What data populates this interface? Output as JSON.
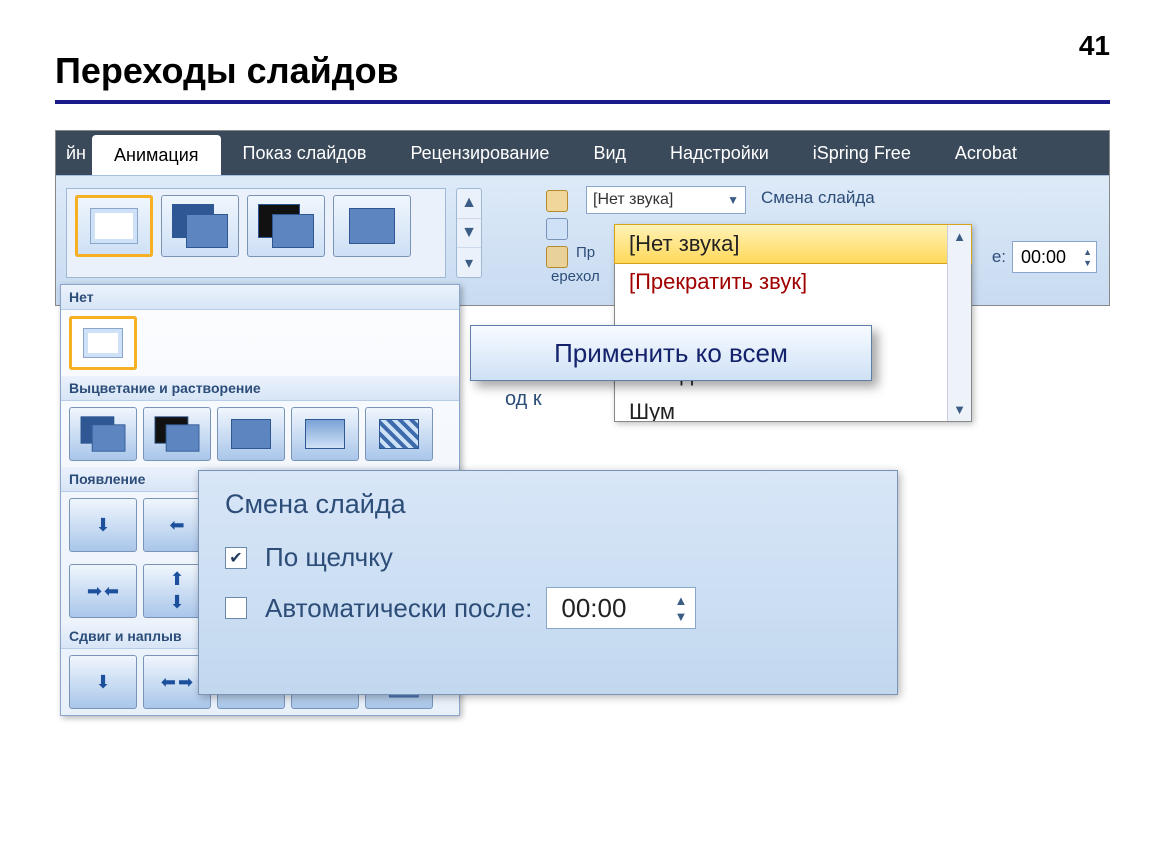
{
  "page": {
    "number": "41",
    "title": "Переходы слайдов"
  },
  "ribbon": {
    "partial_prev_tab": "йн",
    "tabs": [
      "Анимация",
      "Показ слайдов",
      "Рецензирование",
      "Вид",
      "Надстройки",
      "iSpring Free",
      "Acrobat"
    ],
    "active_tab": "Анимация",
    "sound_combo_value": "[Нет звука]",
    "advance_section_label": "Смена слайда",
    "time_suffix_label": "е:",
    "time_value": "00:00",
    "behind_text1": "Пр",
    "behind_text2": "ерехол",
    "behind_text3": "од к"
  },
  "gallery": {
    "group_none": "Нет",
    "group_fade": "Выцветание и растворение",
    "group_appear": "Появление",
    "group_push": "Сдвиг и наплыв"
  },
  "sound_dropdown": {
    "items": [
      "[Нет звука]",
      "[Прекратить звук]",
      "Аплодисменты",
      "Шум"
    ],
    "selected_index": 0
  },
  "callout": {
    "label": "Применить ко всем"
  },
  "advance": {
    "title": "Смена слайда",
    "on_click_label": "По щелчку",
    "on_click_checked": true,
    "auto_after_label": "Автоматически после:",
    "auto_after_checked": false,
    "auto_after_value": "00:00"
  }
}
